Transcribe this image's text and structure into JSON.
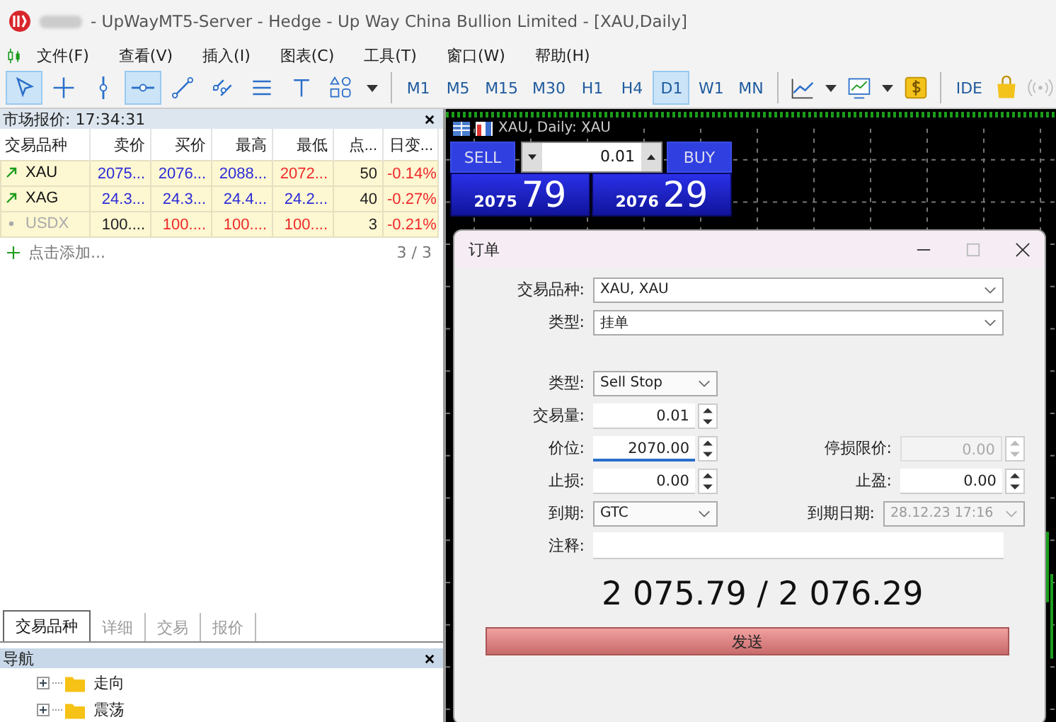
{
  "window": {
    "title": "- UpWayMT5-Server - Hedge - Up Way China Bullion Limited - [XAU,Daily]"
  },
  "menu": [
    "文件(F)",
    "查看(V)",
    "插入(I)",
    "图表(C)",
    "工具(T)",
    "窗口(W)",
    "帮助(H)"
  ],
  "tools": [
    {
      "kind": "cursor",
      "selected": true
    },
    {
      "kind": "crosshair",
      "selected": false
    },
    {
      "kind": "vline",
      "selected": false
    },
    {
      "kind": "hline",
      "selected": true
    },
    {
      "kind": "trend",
      "selected": false
    },
    {
      "kind": "channel",
      "selected": false
    },
    {
      "kind": "fibo",
      "selected": false
    },
    {
      "kind": "text",
      "selected": false
    },
    {
      "kind": "shapes",
      "selected": false
    }
  ],
  "timeframes": [
    {
      "label": "M1",
      "selected": false
    },
    {
      "label": "M5",
      "selected": false
    },
    {
      "label": "M15",
      "selected": false
    },
    {
      "label": "M30",
      "selected": false
    },
    {
      "label": "H1",
      "selected": false
    },
    {
      "label": "H4",
      "selected": false
    },
    {
      "label": "D1",
      "selected": true
    },
    {
      "label": "W1",
      "selected": false
    },
    {
      "label": "MN",
      "selected": false
    }
  ],
  "toolbar_right": {
    "ide": "IDE"
  },
  "market_watch": {
    "title": "市场报价: 17:34:31",
    "columns": [
      "交易品种",
      "卖价",
      "买价",
      "最高",
      "最低",
      "点...",
      "日变..."
    ],
    "rows": [
      {
        "kind": "up",
        "cells": [
          {
            "text": "XAU"
          },
          {
            "text": "2075...",
            "color": "#2b2bd8"
          },
          {
            "text": "2076...",
            "color": "#2b2bd8"
          },
          {
            "text": "2088...",
            "color": "#2b2bd8"
          },
          {
            "text": "2072...",
            "color": "#ee2a2a"
          },
          {
            "text": "50",
            "color": "#222222"
          },
          {
            "text": "-0.14%",
            "color": "#ee2a2a"
          }
        ]
      },
      {
        "kind": "up",
        "cells": [
          {
            "text": "XAG"
          },
          {
            "text": "24.3...",
            "color": "#2b2bd8"
          },
          {
            "text": "24.3...",
            "color": "#2b2bd8"
          },
          {
            "text": "24.4...",
            "color": "#2b2bd8"
          },
          {
            "text": "24.2...",
            "color": "#2b2bd8"
          },
          {
            "text": "40",
            "color": "#222222"
          },
          {
            "text": "-0.27%",
            "color": "#ee2a2a"
          }
        ]
      },
      {
        "kind": "inactive",
        "cells": [
          {
            "text": "USDX"
          },
          {
            "text": "100....",
            "color": "#222222"
          },
          {
            "text": "100....",
            "color": "#ee2a2a"
          },
          {
            "text": "100....",
            "color": "#ee2a2a"
          },
          {
            "text": "100....",
            "color": "#ee2a2a"
          },
          {
            "text": "3",
            "color": "#222222"
          },
          {
            "text": "-0.21%",
            "color": "#ee2a2a"
          }
        ]
      }
    ],
    "add_label": "点击添加...",
    "count": "3 / 3",
    "tabs": [
      {
        "label": "交易品种",
        "selected": true
      },
      {
        "label": "详细",
        "selected": false
      },
      {
        "label": "交易",
        "selected": false
      },
      {
        "label": "报价",
        "selected": false
      }
    ]
  },
  "navigator": {
    "title": "导航",
    "items": [
      {
        "label": "走向",
        "expanded": false
      },
      {
        "label": "震荡",
        "expanded": false
      }
    ]
  },
  "chart": {
    "title": "XAU, Daily: XAU",
    "sell": {
      "label": "SELL",
      "big": "2075",
      "small": "79"
    },
    "buy": {
      "label": "BUY",
      "big": "2076",
      "small": "29"
    },
    "volume": "0.01"
  },
  "order_dialog": {
    "title": "订单",
    "symbol": {
      "label": "交易品种:",
      "value": "XAU, XAU"
    },
    "type": {
      "label": "类型:",
      "value": "挂单"
    },
    "order_type": {
      "label": "类型:",
      "value": "Sell Stop"
    },
    "volume": {
      "label": "交易量:",
      "value": "0.01"
    },
    "price": {
      "label": "价位:",
      "value": "2070.00"
    },
    "stop_limit": {
      "label": "停损限价:",
      "value": "0.00",
      "disabled": true
    },
    "stop_loss": {
      "label": "止损:",
      "value": "0.00"
    },
    "take_profit": {
      "label": "止盈:",
      "value": "0.00"
    },
    "expiration": {
      "label": "到期:",
      "value": "GTC"
    },
    "expiration_date": {
      "label": "到期日期:",
      "value": "28.12.23 17:16",
      "disabled": true
    },
    "comment": {
      "label": "注释:"
    },
    "quote": "2 075.79 / 2 076.29",
    "send": "发送"
  }
}
